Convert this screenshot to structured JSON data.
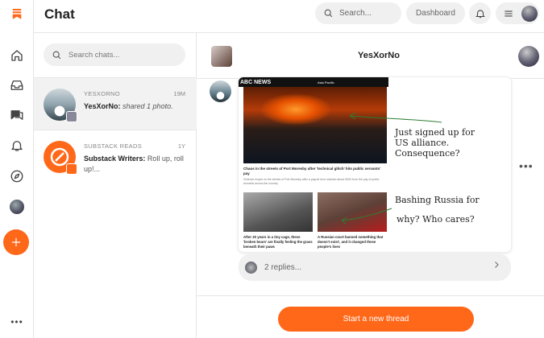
{
  "header": {
    "title": "Chat",
    "search_placeholder": "Search...",
    "dashboard_label": "Dashboard"
  },
  "sidebar": {
    "icons": [
      "substack-logo-icon",
      "home-icon",
      "inbox-icon",
      "chat-icon",
      "bell-icon",
      "compass-icon",
      "profile-avatar",
      "create-plus-icon",
      "more-icon"
    ],
    "more_label": "•••"
  },
  "chat_list": {
    "search_placeholder": "Search chats...",
    "items": [
      {
        "name": "YESXORNO",
        "time": "19M",
        "sender": "YesXorNo:",
        "message": "shared 1 photo."
      },
      {
        "name": "SUBSTACK READS",
        "time": "1Y",
        "sender": "Substack Writers:",
        "message": "Roll up, roll up!..."
      }
    ]
  },
  "conversation": {
    "title": "YesXorNo",
    "post": {
      "news_brand": "ABC NEWS",
      "news_category": "Asia Pacific",
      "headline_main": "Chaos in the streets of Port Moresby after 'technical glitch' hits public servants' pay",
      "subtext_main": "Violence erupts on the streets of Port Moresby after a payroll error slashed about 5000 from the pay of public servants across the country.",
      "headline_left": "After 20 years in a tiny cage, these 'broken bears' are finally feeling the grass beneath their paws",
      "headline_right": "A Russian court banned something that doesn't exist', and it changed these people's lives",
      "annotation_top": "Just signed up for US alliance. Consequence?",
      "annotation_bottom_1": "Bashing Russia for",
      "annotation_bottom_2": "why? Who cares?"
    },
    "more_label": "•••",
    "replies_label": "2 replies...",
    "new_thread_label": "Start a new thread"
  },
  "colors": {
    "accent": "#ff6719",
    "annotation_ink": "#2e7d32"
  }
}
